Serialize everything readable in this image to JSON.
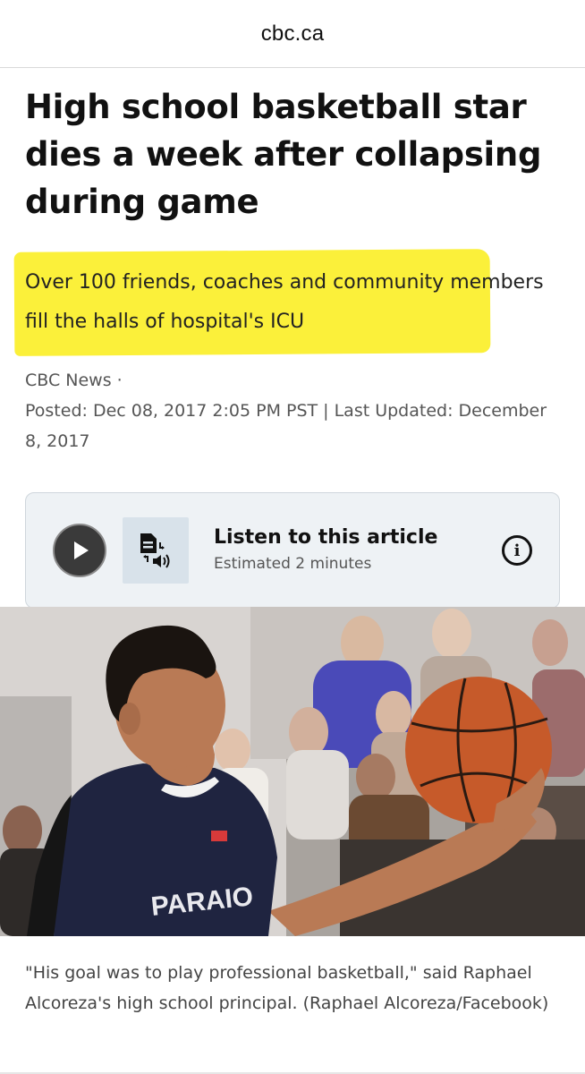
{
  "browser": {
    "host": "cbc.ca"
  },
  "article": {
    "headline": "High school basketball star dies a week after collapsing during game",
    "deck": "Over 100 friends, coaches and community members fill the halls of hospital's ICU",
    "source": "CBC News ·",
    "posted": "Posted: Dec 08, 2017 2:05 PM PST | Last Updated: December 8, 2017"
  },
  "audio": {
    "title": "Listen to this article",
    "estimate": "Estimated 2 minutes",
    "icons": [
      "play-icon",
      "text-to-speech-icon",
      "info-icon"
    ]
  },
  "photo": {
    "caption": "\"His goal was to play professional basketball,\" said Raphael Alcoreza's high school principal. (Raphael Alcoreza/Facebook)"
  },
  "colors": {
    "highlight": "#fbf03a",
    "audio_panel": "#eef2f5",
    "play_button": "#3a3a3a",
    "jersey": "#1f2440",
    "basketball": "#c65a2a"
  }
}
